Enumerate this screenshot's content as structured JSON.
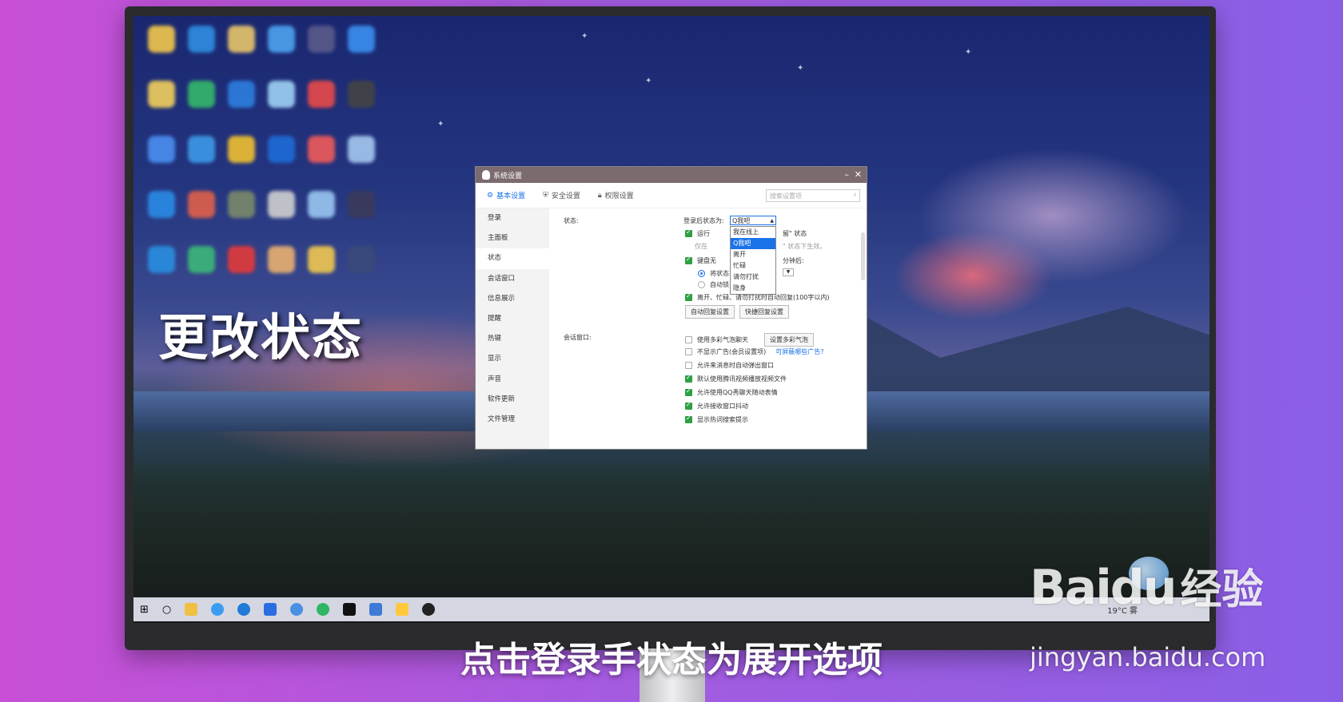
{
  "overlay": {
    "title": "更改状态"
  },
  "subtitle": "点击登录手状态为展开选项",
  "watermark": {
    "logo": "Baidu",
    "cn": "经验",
    "url": "jingyan.baidu.com"
  },
  "window": {
    "title": "系统设置",
    "tabs": [
      {
        "label": "基本设置",
        "icon": "gear-icon",
        "active": true
      },
      {
        "label": "安全设置",
        "icon": "shield-icon"
      },
      {
        "label": "权限设置",
        "icon": "lock-icon"
      }
    ],
    "search_placeholder": "搜索设置项",
    "sidebar": [
      "登录",
      "主面板",
      "状态",
      "会话窗口",
      "信息展示",
      "提醒",
      "热键",
      "显示",
      "声音",
      "软件更新",
      "文件管理"
    ],
    "status_section": {
      "label": "状态:",
      "login_status_label": "登录后状态为:",
      "dropdown_value": "Q我吧",
      "dropdown_options": [
        "我在线上",
        "Q我吧",
        "离开",
        "忙碌",
        "请勿打扰",
        "隐身"
      ],
      "run_option_prefix": "运行",
      "run_option_suffix": "留\" 状态",
      "hint_prefix": "仅在",
      "hint_suffix": "\" 状态下生效。",
      "keyboard_prefix": "键盘无",
      "minutes_label": "分钟后:",
      "radio_1": "将状态",
      "radio_2": "自动锁",
      "auto_reply": "离开、忙碌、请勿打扰时自动回复(100字以内)",
      "auto_reply_btn": "自动回复设置",
      "quick_reply_btn": "快捷回复设置"
    },
    "chat_section": {
      "label": "会话窗口:",
      "items": [
        {
          "text": "使用多彩气泡聊天",
          "checked": false,
          "button": "设置多彩气泡"
        },
        {
          "text": "不显示广告(会员设置项)",
          "checked": false,
          "link": "可屏蔽哪些广告?"
        },
        {
          "text": "允许来消息时自动弹出窗口",
          "checked": false
        },
        {
          "text": "默认使用腾讯视频播放视频文件",
          "checked": true
        },
        {
          "text": "允许使用QQ秀聊天随动表情",
          "checked": true
        },
        {
          "text": "允许接收窗口抖动",
          "checked": true
        },
        {
          "text": "显示热词搜索提示",
          "checked": true
        }
      ]
    }
  },
  "taskbar": {
    "weather": "19°C 雾"
  }
}
